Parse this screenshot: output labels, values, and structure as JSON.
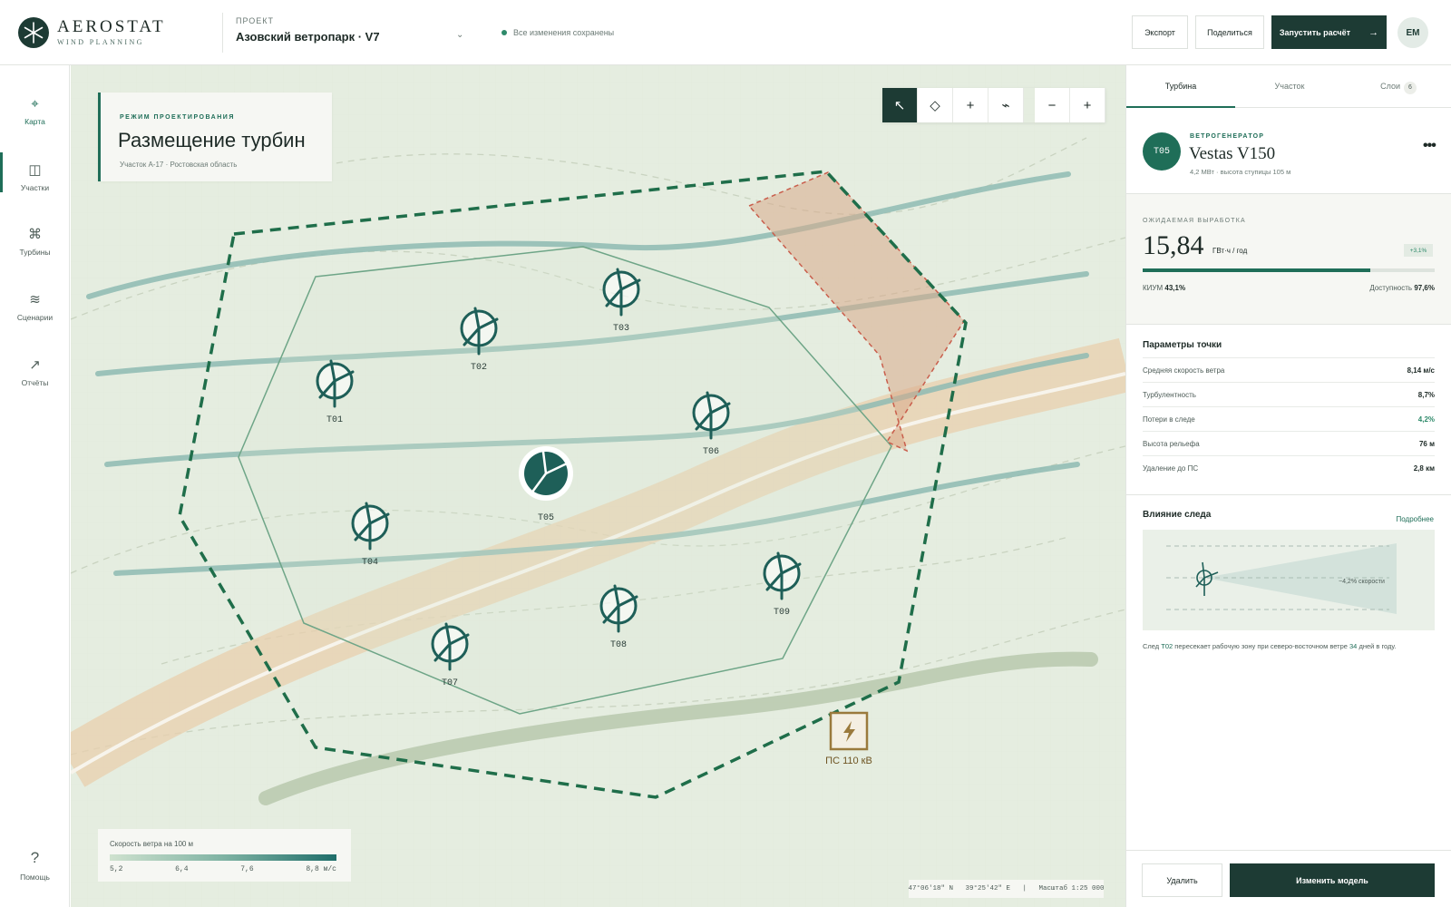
{
  "app": {
    "name": "AEROSTAT",
    "subtitle": "WIND PLANNING"
  },
  "project": {
    "label": "ПРОЕКТ",
    "name": "Азовский ветропарк · V7",
    "save_status": "Все изменения сохранены"
  },
  "header_actions": {
    "export": "Экспорт",
    "share": "Поделиться",
    "run": "Запустить расчёт",
    "run_arrow": "→",
    "avatar": "ЕМ"
  },
  "nav": {
    "items": [
      {
        "label": "Карта",
        "icon": "crosshair-icon",
        "glyph": "⌖"
      },
      {
        "label": "Участки",
        "icon": "parcels-icon",
        "glyph": "◫"
      },
      {
        "label": "Турбины",
        "icon": "turbines-icon",
        "glyph": "⌘"
      },
      {
        "label": "Сценарии",
        "icon": "scenarios-icon",
        "glyph": "≋"
      },
      {
        "label": "Отчёты",
        "icon": "reports-icon",
        "glyph": "↗"
      }
    ],
    "help": {
      "label": "Помощь",
      "glyph": "?"
    }
  },
  "map": {
    "mode_tag": "РЕЖИМ ПРОЕКТИРОВАНИЯ",
    "title": "Размещение турбин",
    "subtitle": "Участок А-17 · Ростовская область",
    "tools": [
      "↖",
      "◇",
      "+",
      "⌁"
    ],
    "zoom": [
      "−",
      "+"
    ],
    "turbines": [
      "T01",
      "T02",
      "T03",
      "T04",
      "T05",
      "T06",
      "T07",
      "T08",
      "T09"
    ],
    "substation": "ПС 110 кВ",
    "legend": {
      "title": "Скорость ветра на 100 м",
      "ticks": [
        "5,2",
        "6,4",
        "7,6",
        "8,8 м/с"
      ]
    },
    "coords": "47°06′18″ N   39°25′42″ E   |   Масштаб 1:25 000"
  },
  "panel": {
    "tabs": [
      {
        "label": "Турбина"
      },
      {
        "label": "Участок"
      },
      {
        "label": "Слои",
        "badge": "6"
      }
    ],
    "turbine": {
      "id": "T05",
      "kind": "ВЕТРОГЕНЕРАТОР",
      "model": "Vestas V150",
      "spec": "4,2 МВт · высота ступицы 105 м",
      "more": "•••"
    },
    "yield": {
      "label": "ОЖИДАЕМАЯ ВЫРАБОТКА",
      "value": "15,84",
      "unit": "ГВт·ч / год",
      "delta": "+3,1%",
      "progress": 0.78,
      "kium_label": "КИУМ",
      "kium": "43,1%",
      "avail_label": "Доступность",
      "avail": "97,6%"
    },
    "params": {
      "title": "Параметры точки",
      "rows": [
        {
          "label": "Средняя скорость ветра",
          "value": "8,14 м/с"
        },
        {
          "label": "Турбулентность",
          "value": "8,7%"
        },
        {
          "label": "Потери в следе",
          "value": "4,2%"
        },
        {
          "label": "Высота рельефа",
          "value": "76 м"
        },
        {
          "label": "Удаление до ПС",
          "value": "2,8 км"
        }
      ]
    },
    "wake": {
      "title": "Влияние следа",
      "more": "Подробнее",
      "annot": "−4,2% скорости",
      "note_pre": "След ",
      "note_id": "T02",
      "note_mid": " пересекает рабочую зону при северо-восточном ветре ",
      "note_days": "34",
      "note_post": " дней в году."
    },
    "footer": {
      "delete": "Удалить",
      "edit": "Изменить модель"
    }
  },
  "colors": {
    "accent": "#1f6e58",
    "dark": "#1d3b34",
    "boundary": "#1f6e4a",
    "exclusion": "#d9a98a",
    "substation": "#9a7a3c"
  }
}
